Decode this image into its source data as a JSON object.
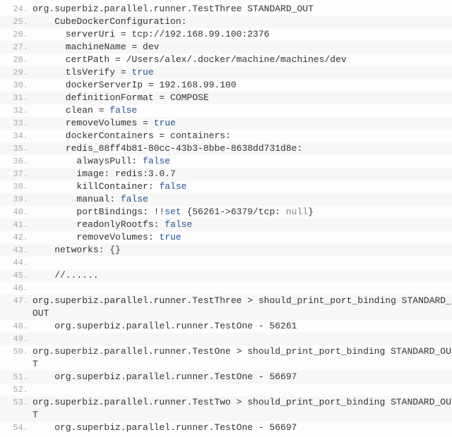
{
  "lines": [
    {
      "n": 24,
      "segs": [
        {
          "t": "org.superbiz.parallel.runner.TestThree STANDARD_OUT"
        }
      ]
    },
    {
      "n": 25,
      "segs": [
        {
          "t": "    CubeDockerConfiguration:"
        }
      ]
    },
    {
      "n": 26,
      "segs": [
        {
          "t": "      serverUri = tcp://192.168.99.100:2376"
        }
      ]
    },
    {
      "n": 27,
      "segs": [
        {
          "t": "      machineName = dev"
        }
      ]
    },
    {
      "n": 28,
      "segs": [
        {
          "t": "      certPath = /Users/alex/.docker/machine/machines/dev"
        }
      ]
    },
    {
      "n": 29,
      "segs": [
        {
          "t": "      tlsVerify = "
        },
        {
          "t": "true",
          "c": "kw"
        }
      ]
    },
    {
      "n": 30,
      "segs": [
        {
          "t": "      dockerServerIp = 192.168.99.100"
        }
      ]
    },
    {
      "n": 31,
      "segs": [
        {
          "t": "      definitionFormat = COMPOSE"
        }
      ]
    },
    {
      "n": 32,
      "segs": [
        {
          "t": "      clean = "
        },
        {
          "t": "false",
          "c": "kw"
        }
      ]
    },
    {
      "n": 33,
      "segs": [
        {
          "t": "      removeVolumes = "
        },
        {
          "t": "true",
          "c": "kw"
        }
      ]
    },
    {
      "n": 34,
      "segs": [
        {
          "t": "      dockerContainers = containers:"
        }
      ]
    },
    {
      "n": 35,
      "segs": [
        {
          "t": "      redis_88ff4b81-80cc-43b3-8bbe-8638dd731d8e:"
        }
      ]
    },
    {
      "n": 36,
      "segs": [
        {
          "t": "        alwaysPull: "
        },
        {
          "t": "false",
          "c": "kw"
        }
      ]
    },
    {
      "n": 37,
      "segs": [
        {
          "t": "        image: redis:3.0.7"
        }
      ]
    },
    {
      "n": 38,
      "segs": [
        {
          "t": "        killContainer: "
        },
        {
          "t": "false",
          "c": "kw"
        }
      ]
    },
    {
      "n": 39,
      "segs": [
        {
          "t": "        manual: "
        },
        {
          "t": "false",
          "c": "kw"
        }
      ]
    },
    {
      "n": 40,
      "segs": [
        {
          "t": "        portBindings: !!"
        },
        {
          "t": "set",
          "c": "kw"
        },
        {
          "t": " {56261->6379/tcp: "
        },
        {
          "t": "null",
          "c": "nul"
        },
        {
          "t": "}"
        }
      ]
    },
    {
      "n": 41,
      "segs": [
        {
          "t": "        readonlyRootfs: "
        },
        {
          "t": "false",
          "c": "kw"
        }
      ]
    },
    {
      "n": 42,
      "segs": [
        {
          "t": "        removeVolumes: "
        },
        {
          "t": "true",
          "c": "kw"
        }
      ]
    },
    {
      "n": 43,
      "segs": [
        {
          "t": "    networks: {}"
        }
      ]
    },
    {
      "n": 44,
      "segs": [
        {
          "t": ""
        }
      ]
    },
    {
      "n": 45,
      "segs": [
        {
          "t": "    //......"
        }
      ]
    },
    {
      "n": 46,
      "segs": [
        {
          "t": ""
        }
      ]
    },
    {
      "n": 47,
      "segs": [
        {
          "t": "org.superbiz.parallel.runner.TestThree > should_print_port_binding STANDARD_OUT"
        }
      ],
      "wrap": true
    },
    {
      "n": 48,
      "segs": [
        {
          "t": "    org.superbiz.parallel.runner.TestOne - 56261"
        }
      ]
    },
    {
      "n": 49,
      "segs": [
        {
          "t": ""
        }
      ]
    },
    {
      "n": 50,
      "segs": [
        {
          "t": "org.superbiz.parallel.runner.TestOne > should_print_port_binding STANDARD_OUT"
        }
      ],
      "wrap": true
    },
    {
      "n": 51,
      "segs": [
        {
          "t": "    org.superbiz.parallel.runner.TestOne - 56697"
        }
      ]
    },
    {
      "n": 52,
      "segs": [
        {
          "t": ""
        }
      ]
    },
    {
      "n": 53,
      "segs": [
        {
          "t": "org.superbiz.parallel.runner.TestTwo > should_print_port_binding STANDARD_OUT"
        }
      ],
      "wrap": true
    },
    {
      "n": 54,
      "segs": [
        {
          "t": "    org.superbiz.parallel.runner.TestOne - 56697"
        }
      ]
    }
  ]
}
